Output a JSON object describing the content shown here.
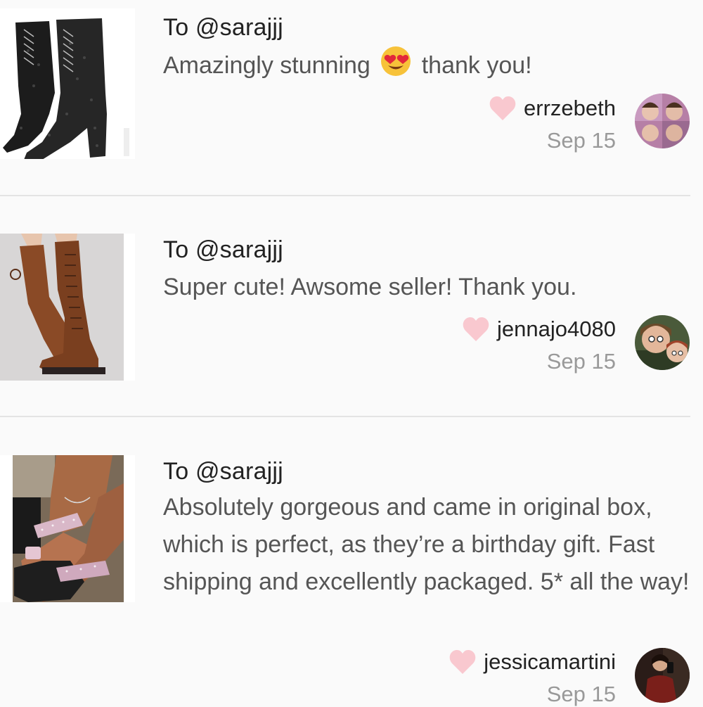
{
  "reviews": [
    {
      "to": "To @sarajjj",
      "comment_before_emoji": "Amazingly stunning",
      "emoji": "heart-eyes-emoji",
      "comment_after_emoji": "thank you!",
      "username": "errzebeth",
      "date": "Sep 15",
      "item_image": "black-glitter-lace-up-boots"
    },
    {
      "to": "To @sarajjj",
      "comment": "Super cute! Awsome seller! Thank you.",
      "username": "jennajo4080",
      "date": "Sep 15",
      "item_image": "brown-over-knee-lace-up-boots"
    },
    {
      "to": "To @sarajjj",
      "comment": "Absolutely gorgeous and came in original box, which is perfect, as they’re a birthday gift. Fast shipping and excellently packaged. 5* all the way!",
      "username": "jessicamartini",
      "date": "Sep 15",
      "item_image": "rhinestone-slide-sandals"
    }
  ],
  "colors": {
    "background": "#fafafa",
    "heart": "#f9c8cf",
    "divider": "#e3e3e3",
    "date_text": "#999999",
    "comment_text": "#555555"
  }
}
